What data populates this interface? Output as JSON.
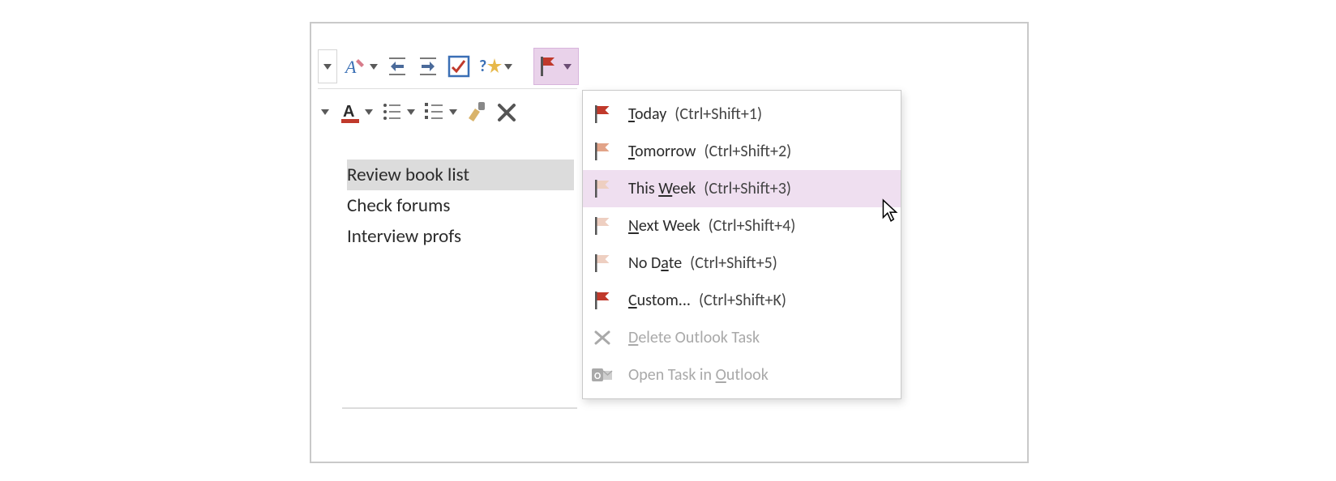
{
  "notes": {
    "lines": [
      "Review book list",
      "Check forums",
      "Interview profs"
    ],
    "selected_index": 0
  },
  "menu": {
    "items": [
      {
        "label_pre": "",
        "u": "T",
        "label_post": "oday",
        "shortcut": "(Ctrl+Shift+1)",
        "flag": "#c0392b"
      },
      {
        "label_pre": "",
        "u": "T",
        "label_post": "omorrow",
        "shortcut": "(Ctrl+Shift+2)",
        "flag": "#e2a388"
      },
      {
        "label_pre": "This ",
        "u": "W",
        "label_post": "eek",
        "shortcut": "(Ctrl+Shift+3)",
        "flag": "#eecfc1",
        "hover": true
      },
      {
        "label_pre": "",
        "u": "N",
        "label_post": "ext Week",
        "shortcut": "(Ctrl+Shift+4)",
        "flag": "#eecfc1"
      },
      {
        "label_pre": "No D",
        "u": "a",
        "label_post": "te",
        "shortcut": "(Ctrl+Shift+5)",
        "flag": "#eecfc1"
      },
      {
        "label_pre": "",
        "u": "C",
        "label_post": "ustom...",
        "shortcut": "(Ctrl+Shift+K)",
        "flag": "#c0392b"
      },
      {
        "label_pre": "",
        "u": "D",
        "label_post": "elete Outlook Task",
        "shortcut": "",
        "icon": "x",
        "disabled": true
      },
      {
        "label_pre": "Open Task in ",
        "u": "O",
        "label_post": "utlook",
        "shortcut": "",
        "icon": "outlook",
        "disabled": true
      }
    ]
  }
}
